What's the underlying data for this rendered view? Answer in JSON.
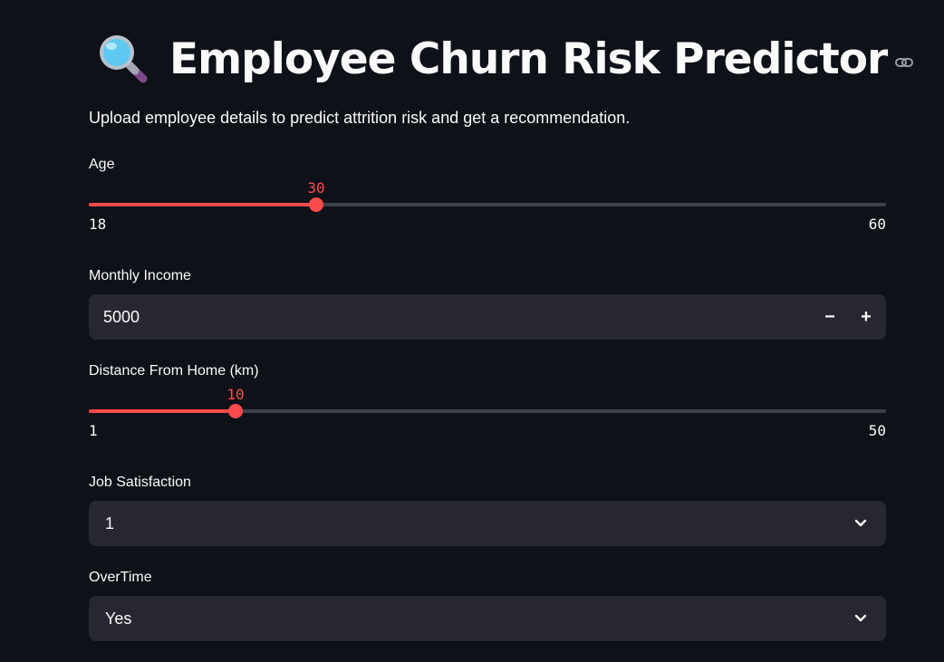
{
  "header": {
    "title": "Employee Churn Risk Predictor",
    "icon": "magnifying-glass-emoji",
    "anchor_icon": "link-icon"
  },
  "subtitle": "Upload employee details to predict attrition risk and get a recommendation.",
  "colors": {
    "background": "#0e1117",
    "accent": "#ff4b4b",
    "widget_bg": "#262730",
    "track": "#3d3f48"
  },
  "form": {
    "age": {
      "label": "Age",
      "value": "30",
      "min": "18",
      "max": "60",
      "fraction": 0.2857
    },
    "monthly_income": {
      "label": "Monthly Income",
      "value": "5000",
      "minus": "−",
      "plus": "+"
    },
    "distance": {
      "label": "Distance From Home (km)",
      "value": "10",
      "min": "1",
      "max": "50",
      "fraction": 0.1837
    },
    "job_satisfaction": {
      "label": "Job Satisfaction",
      "value": "1"
    },
    "overtime": {
      "label": "OverTime",
      "value": "Yes"
    }
  }
}
